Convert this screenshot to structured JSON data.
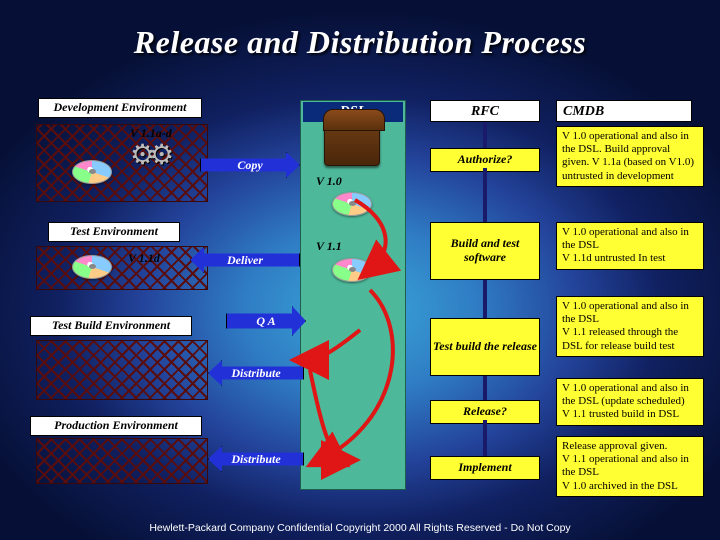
{
  "title": "Release and Distribution Process",
  "dsl": {
    "header": "DSL",
    "v10": "V 1.0",
    "v11": "V 1.1"
  },
  "env": {
    "dev": "Development Environment",
    "dev_ver": "V 1.1a-d",
    "test": "Test Environment",
    "test_ver": "V 1.1d",
    "testbuild": "Test Build Environment",
    "prod": "Production Environment"
  },
  "arrows": {
    "copy": "Copy",
    "deliver": "Deliver",
    "qa": "Q A",
    "distribute1": "Distribute",
    "distribute2": "Distribute"
  },
  "rfc": {
    "header": "RFC",
    "authorize": "Authorize?",
    "build": "Build and test software",
    "testbuild": "Test build the release",
    "release": "Release?",
    "implement": "Implement"
  },
  "cmdb": {
    "header": "CMDB",
    "r1": "V 1.0 operational and also in the DSL. Build approval given. V 1.1a (based on V1.0) untrusted in development",
    "r2": "V 1.0 operational and also in the DSL\nV 1.1d untrusted In test",
    "r3": "V 1.0 operational and also in the DSL\nV 1.1 released through the DSL for release build test",
    "r4": "V 1.0 operational and also in the DSL (update scheduled)\nV 1.1 trusted build in DSL",
    "r5": "Release approval given.\nV 1.1 operational and also in the DSL\nV 1.0 archived in the DSL"
  },
  "footer": "Hewlett-Packard Company Confidential Copyright 2000 All Rights Reserved - Do Not Copy"
}
